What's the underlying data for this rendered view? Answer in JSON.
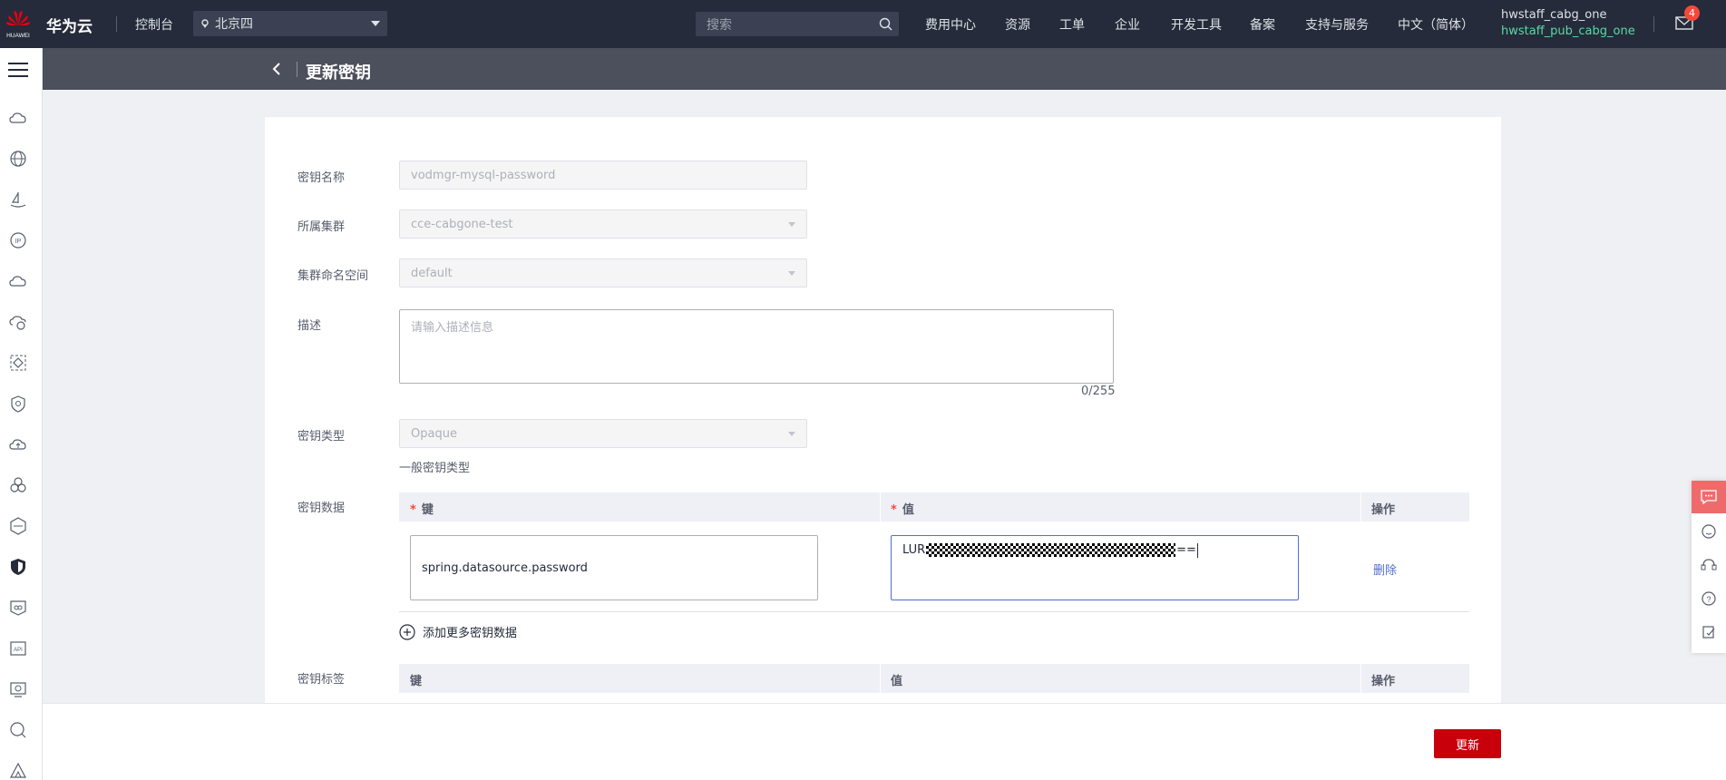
{
  "topbar": {
    "logo_text": "HUAWEI",
    "brand": "华为云",
    "console": "控制台",
    "region": "北京四",
    "search_placeholder": "搜索",
    "nav": [
      "费用中心",
      "资源",
      "工单",
      "企业",
      "开发工具",
      "备案",
      "支持与服务",
      "中文（简体）"
    ],
    "user_primary": "hwstaff_cabg_one",
    "user_secondary": "hwstaff_pub_cabg_one",
    "mail_badge": "4"
  },
  "sidebar": {
    "icons": [
      "cloud-icon",
      "globe-icon",
      "ship-icon",
      "ip-icon",
      "cloud-outline-icon",
      "cloud-cycle-icon",
      "diamond-box-icon",
      "gear-shield-icon",
      "cloud-upload-icon",
      "cluster-icon",
      "hexagon-icon",
      "shield-icon",
      "container-icon",
      "api-icon",
      "monitor-icon",
      "search-icon",
      "tent-icon"
    ]
  },
  "subheader": {
    "title": "更新密钥"
  },
  "form": {
    "name_label": "密钥名称",
    "name_value": "vodmgr-mysql-password",
    "cluster_label": "所属集群",
    "cluster_value": "cce-cabgone-test",
    "namespace_label": "集群命名空间",
    "namespace_value": "default",
    "desc_label": "描述",
    "desc_placeholder": "请输入描述信息",
    "desc_counter": "0/255",
    "type_label": "密钥类型",
    "type_value": "Opaque",
    "type_hint": "一般密钥类型",
    "data_label": "密钥数据",
    "data_table": {
      "col_key": "键",
      "col_value": "值",
      "col_action": "操作",
      "row_key": "spring.datasource.password",
      "row_value_prefix": "LUR",
      "row_value_suffix": "==",
      "row_action": "删除"
    },
    "add_more": "添加更多密钥数据",
    "tag_label": "密钥标签",
    "tag_table": {
      "col_key": "键",
      "col_value": "值",
      "col_action": "操作"
    }
  },
  "footer": {
    "update_button": "更新"
  },
  "colors": {
    "topbar": "#252b3a",
    "subheader": "#4c505c",
    "accent_red": "#c7000b",
    "link_blue": "#526ecc",
    "user_green": "#5ed8a3"
  }
}
